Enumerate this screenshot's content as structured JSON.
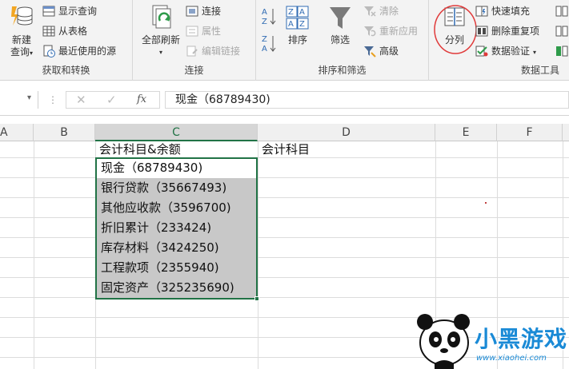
{
  "ribbon": {
    "get_transform": {
      "label": "获取和转换",
      "new_query": "新建",
      "new_query_line2": "查询",
      "show_queries": "显示查询",
      "from_table": "从表格",
      "recent_sources": "最近使用的源"
    },
    "connections": {
      "label": "连接",
      "refresh_all": "全部刷新",
      "connections": "连接",
      "properties": "属性",
      "edit_links": "编辑链接"
    },
    "sort_filter": {
      "label": "排序和筛选",
      "sort": "排序",
      "filter": "筛选",
      "clear": "清除",
      "reapply": "重新应用",
      "advanced": "高级"
    },
    "data_tools": {
      "label": "数据工具",
      "text_to_columns": "分列",
      "flash_fill": "快速填充",
      "remove_duplicates": "删除重复项",
      "data_validation": "数据验证"
    }
  },
  "formula_bar": {
    "fx": "fx",
    "formula": "现金（68789430)"
  },
  "columns": [
    "A",
    "B",
    "C",
    "D",
    "E",
    "F"
  ],
  "cells": {
    "c_header": "会计科目&余额",
    "d_header": "会计科目",
    "rows": [
      "现金（68789430)",
      "银行贷款（35667493)",
      "其他应收款（3596700)",
      "折旧累计（233424)",
      "库存材料（3424250)",
      "工程款项（2355940)",
      "固定资产（325235690)"
    ]
  },
  "watermark": {
    "brand": "小黑游戏",
    "url": "www.xiaohei.com"
  },
  "colors": {
    "accent_green": "#217346",
    "highlight_circle": "#e03a3a",
    "selected_fill": "#c8c8c8"
  }
}
